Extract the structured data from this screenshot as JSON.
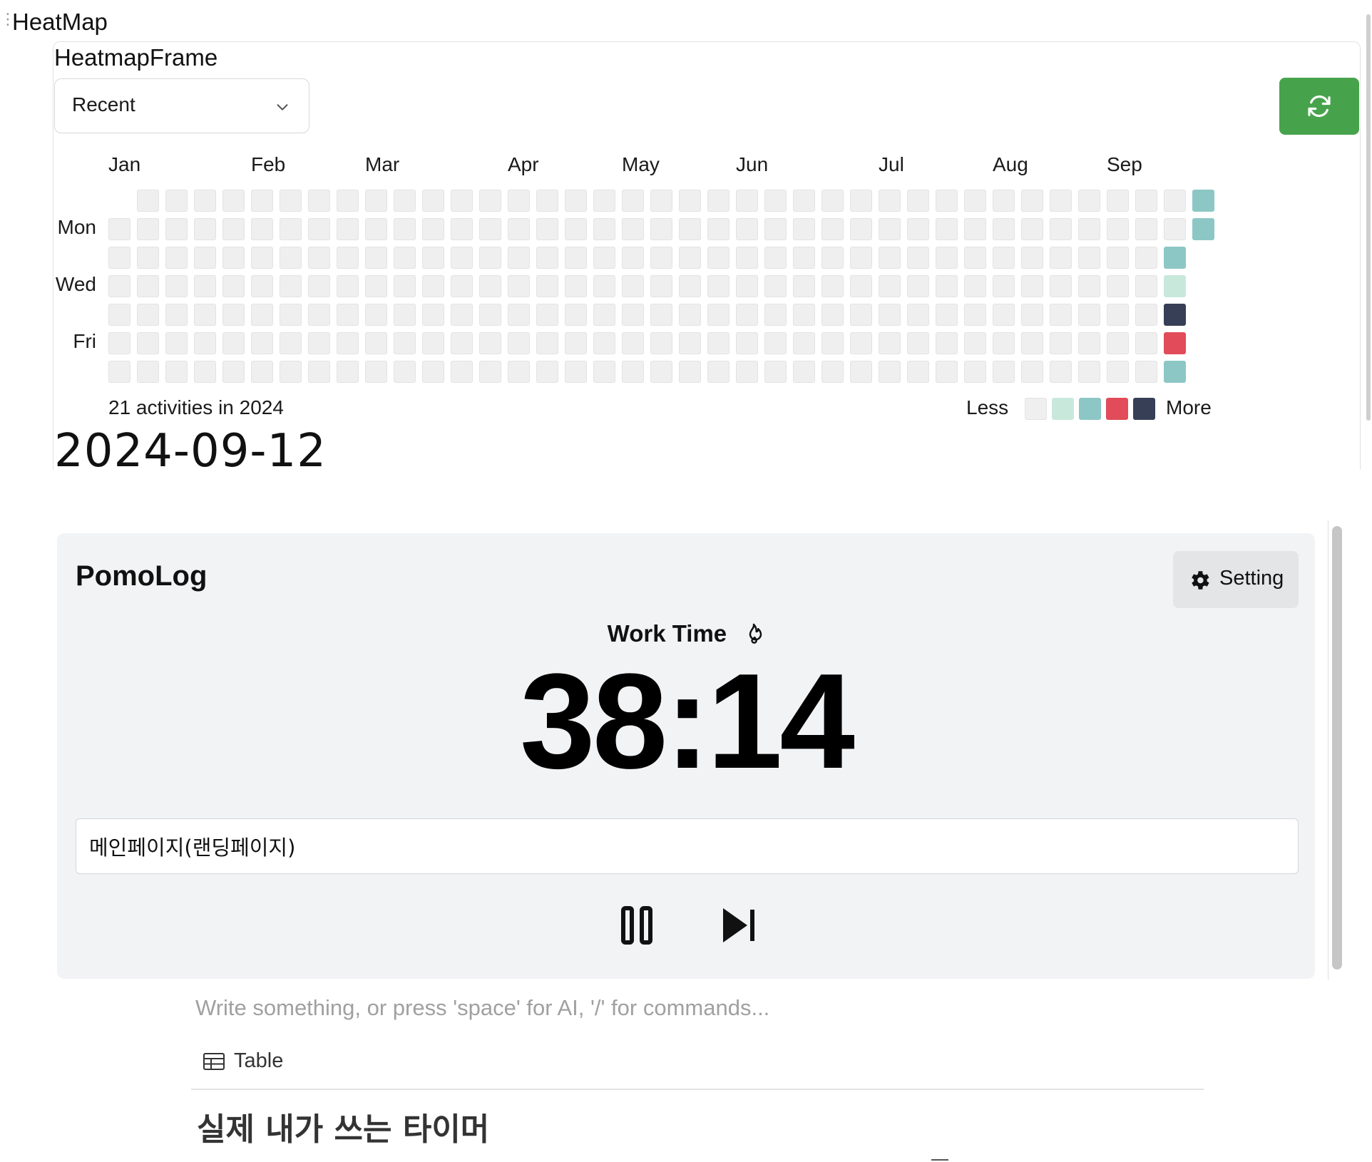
{
  "block": {
    "title": "HeatMap"
  },
  "frame": {
    "title": "HeatmapFrame",
    "range_select": {
      "value": "Recent"
    },
    "refresh_icon": "refresh-icon",
    "accent_color": "#47a34b"
  },
  "heatmap": {
    "months": [
      "Jan",
      "Feb",
      "Mar",
      "Apr",
      "May",
      "Jun",
      "Jul",
      "Aug",
      "Sep"
    ],
    "day_labels": [
      "Mon",
      "Wed",
      "Fri"
    ],
    "summary": "21 activities in 2024",
    "legend": {
      "less": "Less",
      "more": "More",
      "colors": [
        "#efefef",
        "#c9e8dc",
        "#8cc7c5",
        "#e24b5a",
        "#363f55"
      ]
    },
    "active_days": [
      {
        "week": 38,
        "day": 0,
        "level": 2
      },
      {
        "week": 38,
        "day": 1,
        "level": 2
      },
      {
        "week": 37,
        "day": 2,
        "level": 2
      },
      {
        "week": 37,
        "day": 3,
        "level": 1
      },
      {
        "week": 37,
        "day": 4,
        "level": 4
      },
      {
        "week": 37,
        "day": 5,
        "level": 3
      },
      {
        "week": 37,
        "day": 6,
        "level": 2
      }
    ]
  },
  "selected_date": "2024-09-12",
  "pomolog": {
    "title": "PomoLog",
    "setting_label": "Setting",
    "mode_label": "Work Time",
    "timer": "38:14",
    "task_value": "메인페이지(랜딩페이지)"
  },
  "editor": {
    "placeholder": "Write something, or press 'space' for AI, '/' for commands...",
    "table_link": "Table",
    "heading": "실제 내가 쓰는 타이머"
  }
}
